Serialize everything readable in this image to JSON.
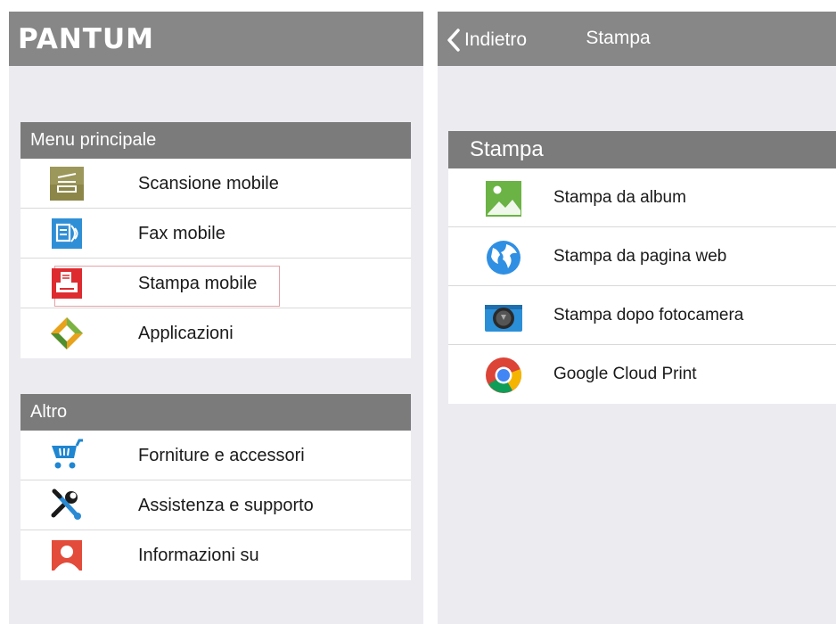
{
  "left": {
    "brand": "PANTUM",
    "sections": [
      {
        "title": "Menu principale",
        "items": [
          {
            "label": "Scansione mobile",
            "icon": "scanner-icon"
          },
          {
            "label": "Fax mobile",
            "icon": "fax-icon"
          },
          {
            "label": "Stampa mobile",
            "icon": "printer-icon",
            "highlighted": true
          },
          {
            "label": "Applicazioni",
            "icon": "applications-icon"
          }
        ]
      },
      {
        "title": "Altro",
        "items": [
          {
            "label": "Forniture e accessori",
            "icon": "shopping-cart-icon"
          },
          {
            "label": "Assistenza e supporto",
            "icon": "tools-icon"
          },
          {
            "label": "Informazioni su",
            "icon": "user-info-icon"
          }
        ]
      }
    ]
  },
  "right": {
    "back_label": "Indietro",
    "title": "Stampa",
    "section_title": "Stampa",
    "items": [
      {
        "label": "Stampa da album",
        "icon": "photo-album-icon"
      },
      {
        "label": "Stampa da pagina web",
        "icon": "globe-icon"
      },
      {
        "label": "Stampa dopo fotocamera",
        "icon": "camera-icon"
      },
      {
        "label": "Google Cloud Print",
        "icon": "chrome-icon"
      }
    ]
  },
  "colors": {
    "topbar": "#878787",
    "section_header": "#7b7b7b",
    "background": "#ebebf0",
    "highlight_border": "#e3a3a7"
  }
}
